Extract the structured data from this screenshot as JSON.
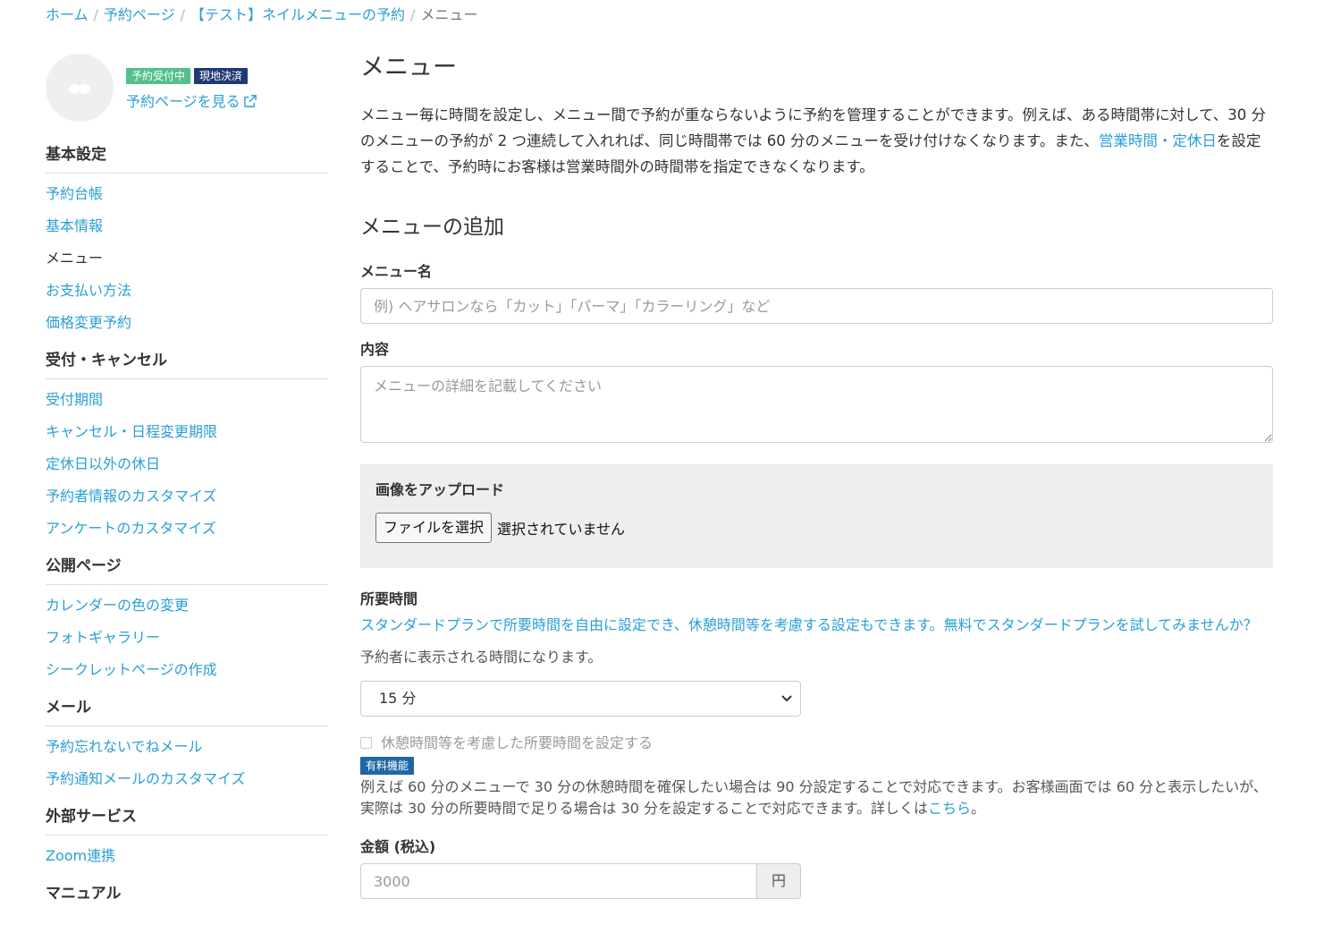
{
  "breadcrumb": {
    "items": [
      "ホーム",
      "予約ページ",
      "【テスト】ネイルメニューの予約"
    ],
    "current": "メニュー",
    "separator": "/"
  },
  "sidebar": {
    "badges": [
      "予約受付中",
      "現地決済"
    ],
    "view_page_link": "予約ページを見る",
    "sections": [
      {
        "header": "基本設定",
        "items": [
          "予約台帳",
          "基本情報",
          "メニュー",
          "お支払い方法",
          "価格変更予約"
        ]
      },
      {
        "header": "受付・キャンセル",
        "items": [
          "受付期間",
          "キャンセル・日程変更期限",
          "定休日以外の休日",
          "予約者情報のカスタマイズ",
          "アンケートのカスタマイズ"
        ]
      },
      {
        "header": "公開ページ",
        "items": [
          "カレンダーの色の変更",
          "フォトギャラリー",
          "シークレットページの作成"
        ]
      },
      {
        "header": "メール",
        "items": [
          "予約忘れないでねメール",
          "予約通知メールのカスタマイズ"
        ]
      },
      {
        "header": "外部サービス",
        "items": [
          "Zoom連携"
        ]
      },
      {
        "header": "マニュアル",
        "items": []
      }
    ]
  },
  "main": {
    "title": "メニュー",
    "description_1": "メニュー毎に時間を設定し、メニュー間で予約が重ならないように予約を管理することができます。例えば、ある時間帯に対して、30 分のメニューの予約が 2 つ連続して入れれば、同じ時間帯では 60 分のメニューを受け付けなくなります。また、",
    "description_link": "営業時間・定休日",
    "description_2": "を設定することで、予約時にお客様は営業時間外の時間帯を指定できなくなります。",
    "add_title": "メニューの追加",
    "name_label": "メニュー名",
    "name_placeholder": "例) ヘアサロンなら「カット」「パーマ」「カラーリング」など",
    "content_label": "内容",
    "content_placeholder": "メニューの詳細を記載してください",
    "upload_label": "画像をアップロード",
    "file_button": "ファイルを選択",
    "file_status": "選択されていません",
    "duration_label": "所要時間",
    "standard_plan_link": "スタンダードプランで所要時間を自由に設定でき、休憩時間等を考慮する設定もできます。無料でスタンダードプランを試してみませんか？",
    "duration_note": "予約者に表示される時間になります。",
    "duration_value": "15 分",
    "break_checkbox_label": "休憩時間等を考慮した所要時間を設定する",
    "paid_badge": "有料機能",
    "break_help_1": "例えば 60 分のメニューで 30 分の休憩時間を確保したい場合は 90 分設定することで対応できます。お客様画面では 60 分と表示したいが、実際は 30 分の所要時間で足りる場合は 30 分を設定することで対応できます。詳しくは",
    "break_help_link": "こちら",
    "break_help_2": "。",
    "price_label": "金額 (税込)",
    "price_placeholder": "3000",
    "price_unit": "円"
  },
  "colors": {
    "link": "#2a9fd6",
    "badge_green": "#53c08b",
    "badge_navy": "#1e3a73",
    "badge_paid": "#1f66a3"
  },
  "icons": {
    "external_link": "external-link-icon",
    "select_chevron": "chevron-down-icon"
  }
}
